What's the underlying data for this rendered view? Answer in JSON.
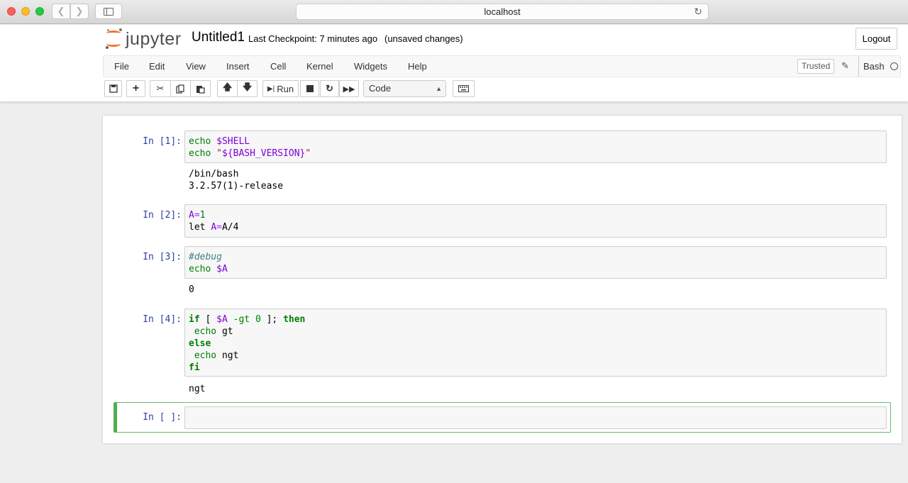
{
  "browser": {
    "url": "localhost"
  },
  "header": {
    "logo_text": "jupyter",
    "notebook_title": "Untitled1",
    "checkpoint": "Last Checkpoint: 7 minutes ago",
    "unsaved": "(unsaved changes)",
    "logout_label": "Logout"
  },
  "menu": {
    "items": [
      "File",
      "Edit",
      "View",
      "Insert",
      "Cell",
      "Kernel",
      "Widgets",
      "Help"
    ],
    "trusted_label": "Trusted",
    "kernel_name": "Bash"
  },
  "toolbar": {
    "run_label": "Run",
    "cell_type": "Code",
    "icons": [
      "save-icon",
      "plus-icon",
      "cut-icon",
      "copy-icon",
      "paste-icon",
      "arrow-up-icon",
      "arrow-down-icon",
      "step-forward-icon",
      "stop-icon",
      "restart-icon",
      "fast-forward-icon",
      "keyboard-icon"
    ]
  },
  "cells": [
    {
      "prompt": "In [1]:",
      "source": [
        "echo $SHELL",
        "echo \"${BASH_VERSION}\""
      ],
      "output": [
        "/bin/bash",
        "3.2.57(1)-release"
      ]
    },
    {
      "prompt": "In [2]:",
      "source": [
        "A=1",
        "let A=A/4"
      ],
      "output": []
    },
    {
      "prompt": "In [3]:",
      "source": [
        "#debug",
        "echo $A"
      ],
      "output": [
        "0"
      ]
    },
    {
      "prompt": "In [4]:",
      "source": [
        "if [ $A -gt 0 ]; then",
        " echo gt",
        "else",
        " echo ngt",
        "fi"
      ],
      "output": [
        "ngt"
      ]
    },
    {
      "prompt": "In [ ]:",
      "source": [],
      "output": []
    }
  ],
  "colors": {
    "prompt": "#303f9f",
    "keyword": "#008000",
    "variable": "#7d00d8",
    "string": "#ba2121",
    "comment": "#408080",
    "active_cell_border": "#66bb6a",
    "logo_orange": "#f37726"
  }
}
